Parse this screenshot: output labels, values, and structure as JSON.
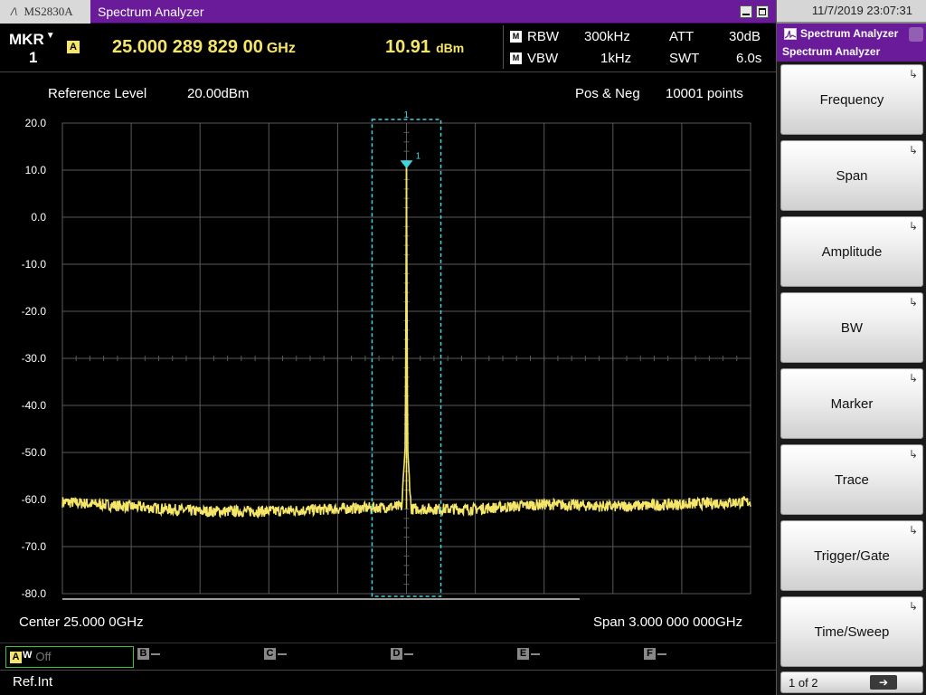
{
  "titlebar": {
    "logo_mark": "/\\",
    "model": "MS2830A",
    "title": "Spectrum Analyzer"
  },
  "marker": {
    "label": "MKR",
    "number": "1",
    "trace_badge": "A",
    "frequency": "25.000 289 829 00",
    "frequency_unit": "GHz",
    "level": "10.91",
    "level_unit": "dBm"
  },
  "params": {
    "rbw_badge": "M",
    "rbw_label": "RBW",
    "rbw_value": "300kHz",
    "vbw_badge": "M",
    "vbw_label": "VBW",
    "vbw_value": "1kHz",
    "att_label": "ATT",
    "att_value": "30dB",
    "swt_label": "SWT",
    "swt_value": "6.0s"
  },
  "plot": {
    "ref_label": "Reference Level",
    "ref_value": "20.00dBm",
    "detector": "Pos & Neg",
    "points": "10001 points",
    "center": "Center 25.000 0GHz",
    "span": "Span 3.000 000 000GHz"
  },
  "traces": {
    "a_label": "A",
    "a_mode": "W",
    "a_state": "Off",
    "b_label": "B",
    "c_label": "C",
    "d_label": "D",
    "e_label": "E",
    "f_label": "F"
  },
  "status": {
    "reference": "Ref.Int"
  },
  "right_panel": {
    "datetime": "11/7/2019 23:07:31",
    "menu_title": "Spectrum Analyzer",
    "menu_subtitle": "Spectrum Analyzer",
    "keys": [
      "Frequency",
      "Span",
      "Amplitude",
      "BW",
      "Marker",
      "Trace",
      "Trigger/Gate",
      "Time/Sweep"
    ],
    "key_arrow": "↳",
    "pager": "1 of 2",
    "next": "➔"
  },
  "colors": {
    "trace": "#f5e66a",
    "marker": "#3fd6e0",
    "grid": "#5a5a5a",
    "menu_header": "#6a1b9a"
  },
  "chart_data": {
    "type": "line",
    "title": "",
    "xlabel": "",
    "ylabel": "",
    "ylim": [
      -80,
      20
    ],
    "y_ticks": [
      "20.0",
      "10.0",
      "0.0",
      "-10.0",
      "-20.0",
      "-30.0",
      "-40.0",
      "-50.0",
      "-60.0",
      "-70.0",
      "-80.0"
    ],
    "y_tick_values": [
      20,
      10,
      0,
      -10,
      -20,
      -30,
      -40,
      -50,
      -60,
      -70,
      -80
    ],
    "xlim_ghz": [
      23.5,
      26.5
    ],
    "grid": true,
    "series": [
      {
        "x_ghz": [
          23.5,
          23.8,
          24.1,
          24.4,
          24.7,
          24.98,
          24.995,
          25.0,
          25.005,
          25.02,
          25.3,
          25.6,
          25.9,
          26.2,
          26.5
        ],
        "y_dbm": [
          -60.5,
          -61.5,
          -62.5,
          -62.5,
          -62,
          -61.5,
          -48,
          10.91,
          -49,
          -62,
          -62,
          -61,
          -61.5,
          -61,
          -60.5
        ]
      }
    ],
    "marker": {
      "label": "1",
      "x_ghz": 25.0002898,
      "y_dbm": 10.91
    },
    "zoom_box": {
      "label": "1",
      "x_ghz": [
        24.85,
        25.15
      ],
      "y_dbm": [
        -80,
        20
      ]
    }
  }
}
